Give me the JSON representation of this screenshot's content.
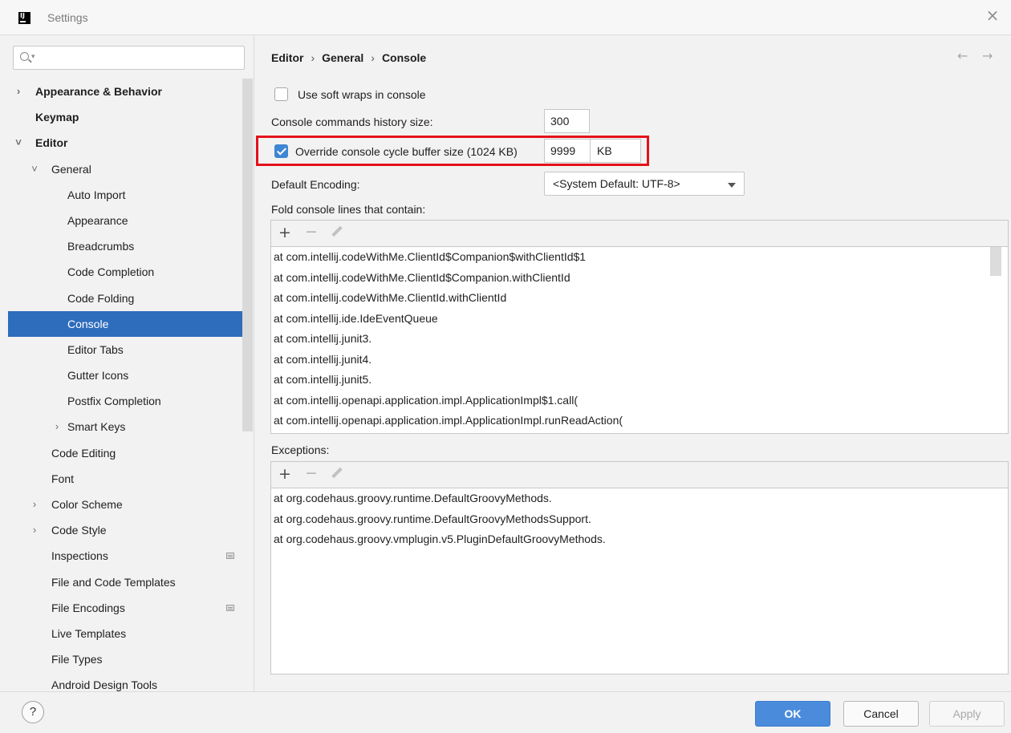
{
  "window": {
    "title": "Settings",
    "app_icon": "IJ",
    "close_icon": "close-icon"
  },
  "sidebar": {
    "search": {
      "value": "",
      "placeholder": ""
    },
    "items": [
      {
        "label": "Appearance & Behavior",
        "level": 0,
        "bold": true,
        "arrow": "›"
      },
      {
        "label": "Keymap",
        "level": 0,
        "bold": true,
        "arrow": ""
      },
      {
        "label": "Editor",
        "level": 0,
        "bold": true,
        "arrow": "˅"
      },
      {
        "label": "General",
        "level": 1,
        "bold": false,
        "arrow": "˅"
      },
      {
        "label": "Auto Import",
        "level": 2,
        "bold": false,
        "arrow": ""
      },
      {
        "label": "Appearance",
        "level": 2,
        "bold": false,
        "arrow": ""
      },
      {
        "label": "Breadcrumbs",
        "level": 2,
        "bold": false,
        "arrow": ""
      },
      {
        "label": "Code Completion",
        "level": 2,
        "bold": false,
        "arrow": ""
      },
      {
        "label": "Code Folding",
        "level": 2,
        "bold": false,
        "arrow": ""
      },
      {
        "label": "Console",
        "level": 2,
        "bold": false,
        "arrow": "",
        "selected": true
      },
      {
        "label": "Editor Tabs",
        "level": 2,
        "bold": false,
        "arrow": ""
      },
      {
        "label": "Gutter Icons",
        "level": 2,
        "bold": false,
        "arrow": ""
      },
      {
        "label": "Postfix Completion",
        "level": 2,
        "bold": false,
        "arrow": ""
      },
      {
        "label": "Smart Keys",
        "level": 2,
        "bold": false,
        "arrow": "›"
      },
      {
        "label": "Code Editing",
        "level": 1,
        "bold": false,
        "arrow": ""
      },
      {
        "label": "Font",
        "level": 1,
        "bold": false,
        "arrow": ""
      },
      {
        "label": "Color Scheme",
        "level": 1,
        "bold": false,
        "arrow": "›"
      },
      {
        "label": "Code Style",
        "level": 1,
        "bold": false,
        "arrow": "›"
      },
      {
        "label": "Inspections",
        "level": 1,
        "bold": false,
        "arrow": "",
        "project_icon": true
      },
      {
        "label": "File and Code Templates",
        "level": 1,
        "bold": false,
        "arrow": ""
      },
      {
        "label": "File Encodings",
        "level": 1,
        "bold": false,
        "arrow": "",
        "project_icon": true
      },
      {
        "label": "Live Templates",
        "level": 1,
        "bold": false,
        "arrow": ""
      },
      {
        "label": "File Types",
        "level": 1,
        "bold": false,
        "arrow": ""
      },
      {
        "label": "Android Design Tools",
        "level": 1,
        "bold": false,
        "arrow": ""
      }
    ]
  },
  "breadcrumb": {
    "items": [
      "Editor",
      "General",
      "Console"
    ],
    "separator": "›",
    "back_icon": "←",
    "forward_icon": "→"
  },
  "settings": {
    "soft_wraps": {
      "label": "Use soft wraps in console",
      "checked": false
    },
    "history": {
      "label": "Console commands history size:",
      "value": "300"
    },
    "override_buffer": {
      "label": "Override console cycle buffer size (1024 KB)",
      "checked": true,
      "value": "9999",
      "unit": "KB"
    },
    "encoding": {
      "label": "Default Encoding:",
      "value": "<System Default: UTF-8>"
    },
    "fold_label": "Fold console lines that contain:",
    "exceptions_label": "Exceptions:"
  },
  "fold_lines": [
    "at com.intellij.codeWithMe.ClientId$Companion$withClientId$1",
    "at com.intellij.codeWithMe.ClientId$Companion.withClientId",
    "at com.intellij.codeWithMe.ClientId.withClientId",
    "at com.intellij.ide.IdeEventQueue",
    "at com.intellij.junit3.",
    "at com.intellij.junit4.",
    "at com.intellij.junit5.",
    "at com.intellij.openapi.application.impl.ApplicationImpl$1.call(",
    "at com.intellij.openapi.application.impl.ApplicationImpl.runReadAction("
  ],
  "exception_lines": [
    "at org.codehaus.groovy.runtime.DefaultGroovyMethods.",
    "at org.codehaus.groovy.runtime.DefaultGroovyMethodsSupport.",
    "at org.codehaus.groovy.vmplugin.v5.PluginDefaultGroovyMethods."
  ],
  "toolbar": {
    "add": "+",
    "remove": "−"
  },
  "footer": {
    "help": "?",
    "ok": "OK",
    "cancel": "Cancel",
    "apply": "Apply"
  },
  "colors": {
    "selection": "#2e6cbc",
    "checkbox_checked": "#3f86d4",
    "ok_button": "#4a8bdc",
    "highlight_box": "#e5111a"
  }
}
